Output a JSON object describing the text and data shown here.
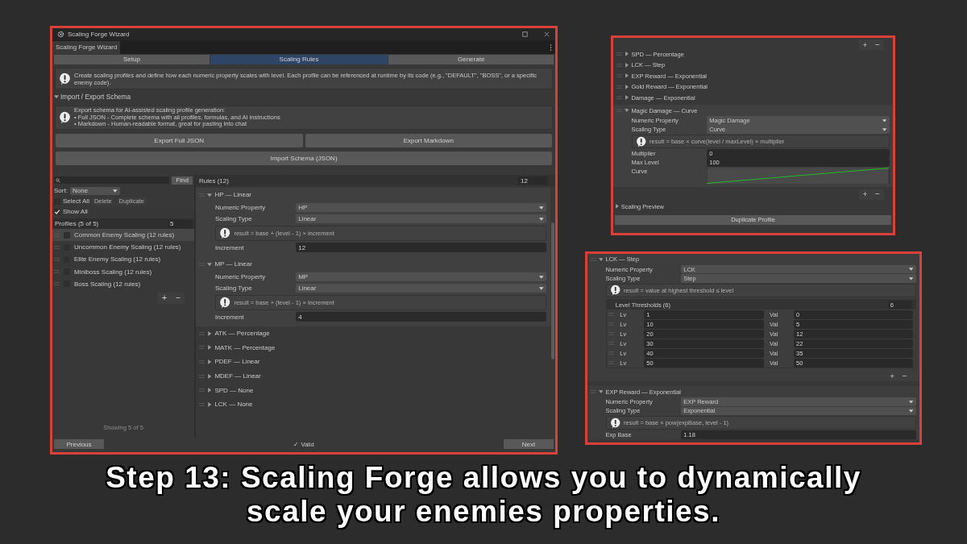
{
  "main_window": {
    "title": "Scaling Forge Wizard",
    "tab_label": "Scaling Forge Wizard",
    "tabs": [
      {
        "label": "Setup",
        "selected": false
      },
      {
        "label": "Scaling Rules",
        "selected": true
      },
      {
        "label": "Generate",
        "selected": false
      }
    ],
    "info_text": "Create scaling profiles and define how each numeric property scales with level. Each profile can be referenced at runtime by its code (e.g., \"DEFAULT\", \"BOSS\", or a specific enemy code).",
    "import_export": {
      "title": "Import / Export Schema",
      "expanded": true,
      "info_lines": [
        "Export schema for AI-assisted scaling profile generation:",
        "• Full JSON - Complete schema with all profiles, formulas, and AI instructions",
        "• Markdown - Human-readable format, great for pasting into chat"
      ],
      "buttons": [
        "Export Full JSON",
        "Export Markdown"
      ],
      "import_button": "Import Schema (JSON)"
    },
    "profiles": {
      "find_button": "Find",
      "sort_label": "Sort:",
      "sort_value": "None",
      "select_all": {
        "label": "Select All",
        "checked": false
      },
      "actions": [
        {
          "label": "Delete",
          "disabled": true
        },
        {
          "label": "Duplicate",
          "disabled": true
        }
      ],
      "show_all": {
        "label": "Show All",
        "checked": true
      },
      "header": "Profiles (5 of 5)",
      "count": "5",
      "items": [
        {
          "name": "Common Enemy Scaling (12 rules)",
          "checked": false,
          "selected": true
        },
        {
          "name": "Uncommon Enemy Scaling (12 rules)",
          "checked": false,
          "selected": false
        },
        {
          "name": "Elite Enemy Scaling (12 rules)",
          "checked": false,
          "selected": false
        },
        {
          "name": "Miniboss Scaling (12 rules)",
          "checked": false,
          "selected": false
        },
        {
          "name": "Boss Scaling (12 rules)",
          "checked": false,
          "selected": false
        }
      ],
      "add": "+",
      "remove": "−",
      "footer": "Showing 5 of 5"
    },
    "rules": {
      "header": "Rules (12)",
      "count": "12",
      "items": [
        {
          "title": "HP — Linear",
          "expanded": true,
          "property_label": "Numeric Property",
          "property": "HP",
          "type_label": "Scaling Type",
          "type": "Linear",
          "formula": "result = base + (level - 1) × increment",
          "params": [
            {
              "kind": "number",
              "label": "Increment",
              "value": "12"
            }
          ]
        },
        {
          "title": "MP — Linear",
          "expanded": true,
          "property_label": "Numeric Property",
          "property": "MP",
          "type_label": "Scaling Type",
          "type": "Linear",
          "formula": "result = base + (level - 1) × increment",
          "params": [
            {
              "kind": "number",
              "label": "Increment",
              "value": "4"
            }
          ]
        },
        {
          "title": "ATK — Percentage",
          "expanded": false
        },
        {
          "title": "MATK — Percentage",
          "expanded": false
        },
        {
          "title": "PDEF — Linear",
          "expanded": false
        },
        {
          "title": "MDEF — Linear",
          "expanded": false
        },
        {
          "title": "SPD — None",
          "expanded": false
        },
        {
          "title": "LCK — None",
          "expanded": false
        }
      ]
    },
    "footer": {
      "previous": "Previous",
      "status": "✓ Valid",
      "next": "Next"
    }
  },
  "curve_panel": {
    "top_add": "+",
    "top_remove": "−",
    "rules": [
      {
        "title": "SPD — Percentage",
        "expanded": false
      },
      {
        "title": "LCK — Step",
        "expanded": false
      },
      {
        "title": "EXP Reward — Exponential",
        "expanded": false
      },
      {
        "title": "Gold Reward — Exponential",
        "expanded": false
      },
      {
        "title": "Damage — Exponential",
        "expanded": false
      },
      {
        "title": "Magic Damage — Curve",
        "expanded": true,
        "property_label": "Numeric Property",
        "property": "Magic Damage",
        "type_label": "Scaling Type",
        "type": "Curve",
        "formula": "result = base × curve(level / maxLevel) × multiplier",
        "params": [
          {
            "kind": "number",
            "label": "Multiplier",
            "value": "0"
          },
          {
            "kind": "number",
            "label": "Max Level",
            "value": "100"
          },
          {
            "kind": "curve",
            "label": "Curve"
          }
        ]
      }
    ],
    "add": "+",
    "remove": "−",
    "preview": {
      "title": "Scaling Preview",
      "expanded": false
    },
    "duplicate_button": "Duplicate Profile"
  },
  "step_panel": {
    "rules": [
      {
        "title": "LCK — Step",
        "expanded": true,
        "property_label": "Numeric Property",
        "property": "LCK",
        "type_label": "Scaling Type",
        "type": "Step",
        "formula": "result = value at highest threshold ≤ level",
        "params": [
          {
            "kind": "thresholds",
            "title": "Level Thresholds (6)",
            "count": "6",
            "add": "+",
            "remove": "−",
            "rows": [
              {
                "lv_label": "Lv",
                "lv": "1",
                "val_label": "Val",
                "val": "0"
              },
              {
                "lv_label": "Lv",
                "lv": "10",
                "val_label": "Val",
                "val": "5"
              },
              {
                "lv_label": "Lv",
                "lv": "20",
                "val_label": "Val",
                "val": "12"
              },
              {
                "lv_label": "Lv",
                "lv": "30",
                "val_label": "Val",
                "val": "22"
              },
              {
                "lv_label": "Lv",
                "lv": "40",
                "val_label": "Val",
                "val": "35"
              },
              {
                "lv_label": "Lv",
                "lv": "50",
                "val_label": "Val",
                "val": "50"
              }
            ]
          }
        ]
      },
      {
        "title": "EXP Reward — Exponential",
        "expanded": true,
        "property_label": "Numeric Property",
        "property": "EXP Reward",
        "type_label": "Scaling Type",
        "type": "Exponential",
        "formula": "result = base × pow(expBase, level - 1)",
        "params": [
          {
            "kind": "number",
            "label": "Exp Base",
            "value": "1.18"
          }
        ]
      }
    ]
  },
  "caption": [
    "Step 13: Scaling Forge allows you to dynamically",
    "scale your enemies properties."
  ]
}
